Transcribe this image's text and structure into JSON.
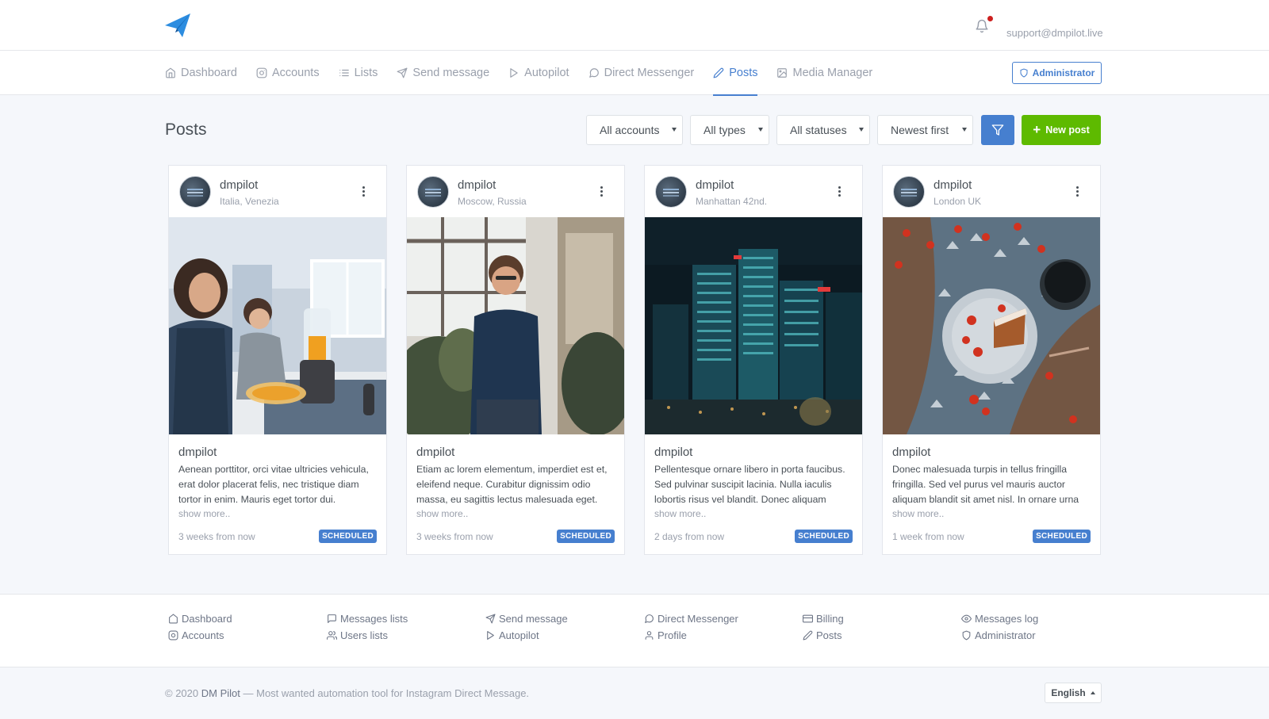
{
  "header": {
    "email": "support@dmpilot.live",
    "logo_icon": "paper-plane-icon",
    "bell_icon": "bell-icon",
    "accent_color": "#467fcf"
  },
  "nav": {
    "items": [
      {
        "label": "Dashboard",
        "icon": "home-icon"
      },
      {
        "label": "Accounts",
        "icon": "instagram-icon"
      },
      {
        "label": "Lists",
        "icon": "list-icon"
      },
      {
        "label": "Send message",
        "icon": "send-icon"
      },
      {
        "label": "Autopilot",
        "icon": "play-icon"
      },
      {
        "label": "Direct Messenger",
        "icon": "message-circle-icon"
      },
      {
        "label": "Posts",
        "icon": "edit-icon",
        "active": true
      },
      {
        "label": "Media Manager",
        "icon": "image-icon"
      }
    ],
    "admin_label": "Administrator"
  },
  "page": {
    "title": "Posts",
    "filters": {
      "accounts": "All accounts",
      "types": "All types",
      "statuses": "All statuses",
      "sort": "Newest first"
    },
    "new_post_label": "New post"
  },
  "posts": [
    {
      "username": "dmpilot",
      "location": "Italia, Venezia",
      "caption_title": "dmpilot",
      "caption": "Aenean porttitor, orci vitae ultricies vehicula, erat dolor placerat felis, nec tristique diam tortor in enim. Mauris eget tortor dui.",
      "show_more": "show more..",
      "when": "3 weeks from now",
      "status": "SCHEDULED"
    },
    {
      "username": "dmpilot",
      "location": "Moscow, Russia",
      "caption_title": "dmpilot",
      "caption": "Etiam ac lorem elementum, imperdiet est et, eleifend neque. Curabitur dignissim odio massa, eu sagittis lectus malesuada eget.",
      "show_more": "show more..",
      "when": "3 weeks from now",
      "status": "SCHEDULED"
    },
    {
      "username": "dmpilot",
      "location": "Manhattan 42nd.",
      "caption_title": "dmpilot",
      "caption": "Pellentesque ornare libero in porta faucibus. Sed pulvinar suscipit lacinia. Nulla iaculis lobortis risus vel blandit. Donec aliquam",
      "show_more": "show more..",
      "when": "2 days from now",
      "status": "SCHEDULED"
    },
    {
      "username": "dmpilot",
      "location": "London UK",
      "caption_title": "dmpilot",
      "caption": "Donec malesuada turpis in tellus fringilla fringilla. Sed vel purus vel mauris auctor aliquam blandit sit amet nisl. In ornare urna",
      "show_more": "show more..",
      "when": "1 week from now",
      "status": "SCHEDULED"
    }
  ],
  "footer": {
    "col1": [
      "Dashboard",
      "Accounts"
    ],
    "col2": [
      "Messages lists",
      "Users lists"
    ],
    "col3": [
      "Send message",
      "Autopilot"
    ],
    "col4": [
      "Direct Messenger",
      "Profile"
    ],
    "col5": [
      "Billing",
      "Posts"
    ],
    "col6": [
      "Messages log",
      "Administrator"
    ],
    "copyright_prefix": "© 2020",
    "brand": "DM Pilot",
    "copyright_suffix": "— Most wanted automation tool for Instagram Direct Message.",
    "language": "English"
  }
}
